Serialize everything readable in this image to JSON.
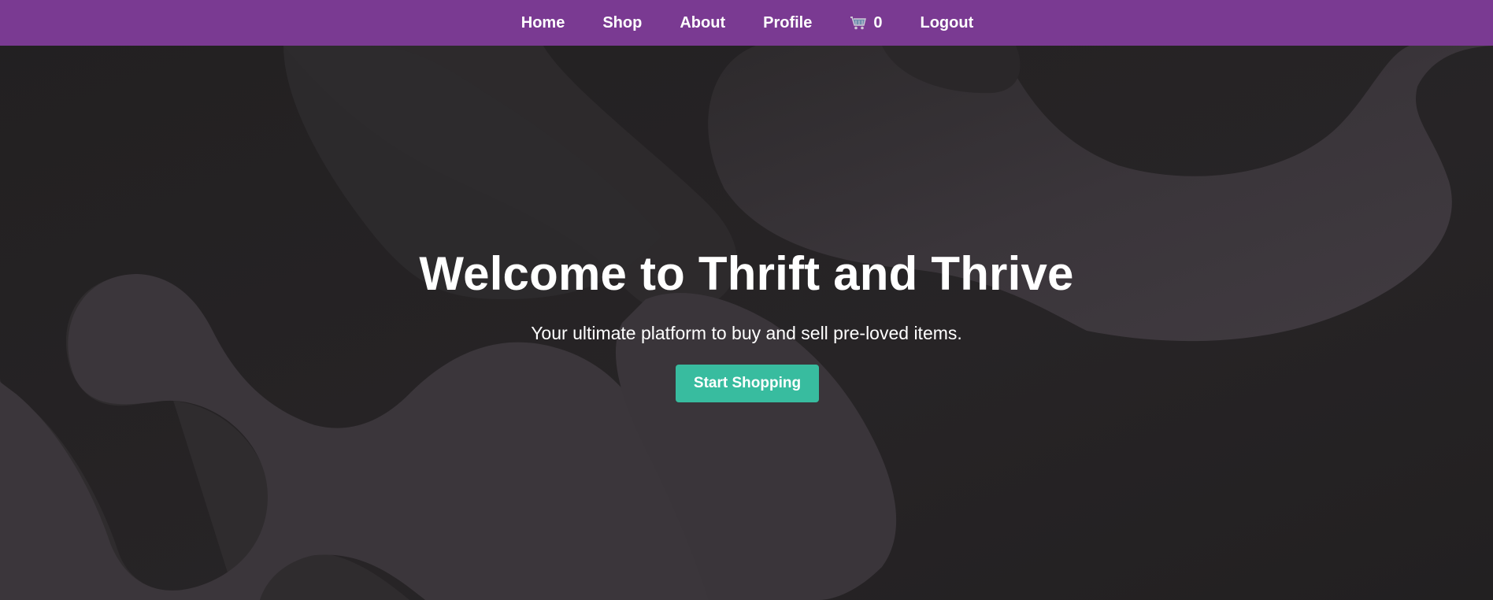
{
  "nav": {
    "items": [
      {
        "label": "Home"
      },
      {
        "label": "Shop"
      },
      {
        "label": "About"
      },
      {
        "label": "Profile"
      }
    ],
    "cart": {
      "icon": "cart-icon",
      "count": "0"
    },
    "logout_label": "Logout"
  },
  "hero": {
    "title": "Welcome to Thrift and Thrive",
    "subtitle": "Your ultimate platform to buy and sell pre-loved items.",
    "cta_label": "Start Shopping"
  },
  "colors": {
    "navbar": "#7a3a92",
    "background": "#232122",
    "blob": "#3d383d",
    "cta": "#38bc9f",
    "text": "#ffffff"
  }
}
